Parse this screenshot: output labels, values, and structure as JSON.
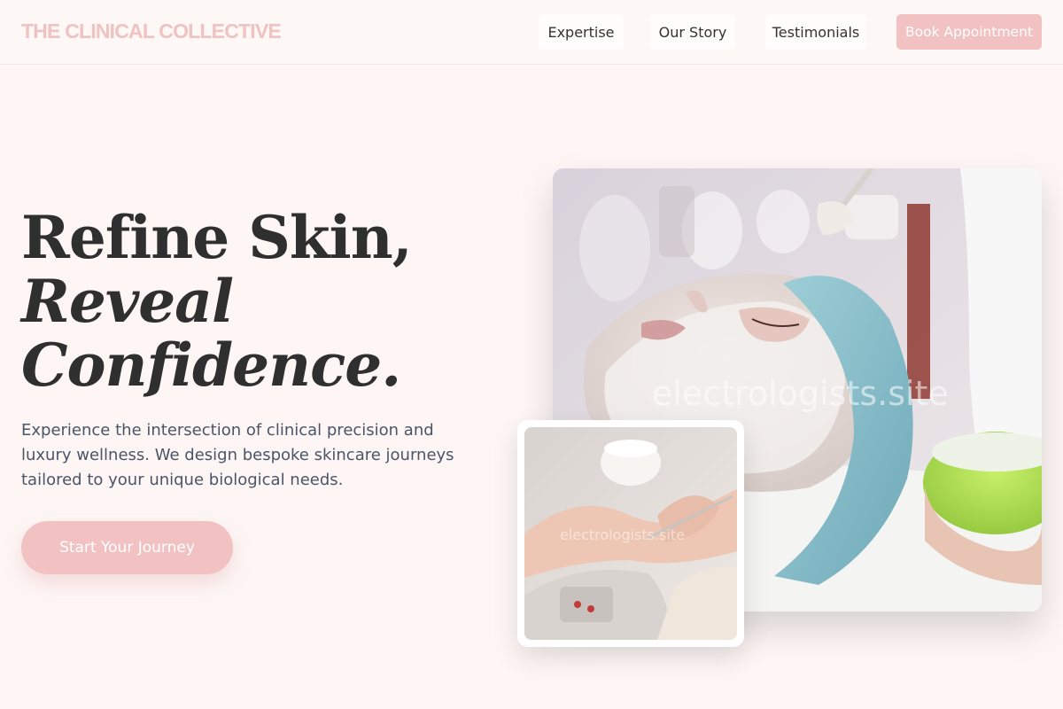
{
  "header": {
    "logo": "THE CLINICAL COLLECTIVE",
    "nav": [
      "Expertise",
      "Our Story",
      "Testimonials"
    ],
    "cta_label": "Book Appointment"
  },
  "hero": {
    "headline_line1": "Refine Skin,",
    "headline_line2": "Reveal",
    "headline_line3": "Confidence.",
    "description": "Experience the intersection of clinical precision and luxury wellness. We design bespoke skincare journeys tailored to your unique biological needs.",
    "cta_label": "Start Your Journey"
  },
  "images": {
    "main_watermark": "electrologists.site",
    "secondary_watermark": "electrologists.site"
  },
  "colors": {
    "accent": "#f2c2c2",
    "logo": "#eec3c2",
    "background": "#fdf6f5",
    "headline": "#2f2f2f",
    "body_text": "#4a5568"
  }
}
